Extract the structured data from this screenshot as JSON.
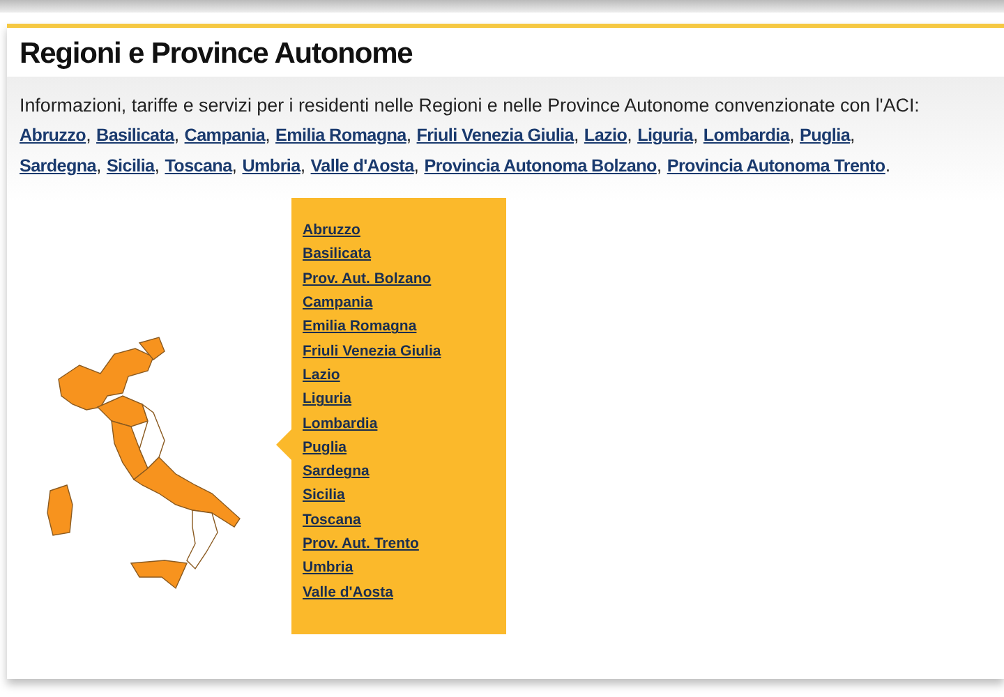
{
  "title": "Regioni e Province Autonome",
  "intro": {
    "text": "Informazioni, tariffe e servizi per i residenti nelle Regioni e nelle Province Autonome convenzionate con l'ACI:",
    "links": [
      {
        "label": "Abruzzo",
        "after": ","
      },
      {
        "label": "Basilicata",
        "after": ","
      },
      {
        "label": "Campania",
        "after": ","
      },
      {
        "label": "Emilia Romagna",
        "after": ","
      },
      {
        "label": "Friuli Venezia Giulia",
        "after": ","
      },
      {
        "label": "Lazio",
        "after": ","
      },
      {
        "label": "Liguria",
        "after": ","
      },
      {
        "label": "Lombardia",
        "after": ","
      },
      {
        "label": "Puglia",
        "after": ","
      },
      {
        "label": "Sardegna",
        "after": ","
      },
      {
        "label": "Sicilia",
        "after": ","
      },
      {
        "label": "Toscana",
        "after": ","
      },
      {
        "label": "Umbria",
        "after": ","
      },
      {
        "label": "Valle d'Aosta",
        "after": ","
      },
      {
        "label": "Provincia Autonoma Bolzano",
        "after": ","
      },
      {
        "label": "Provincia Autonoma Trento",
        "after": "."
      }
    ]
  },
  "region_menu": [
    "Abruzzo",
    "Basilicata",
    "Prov. Aut. Bolzano",
    "Campania",
    "Emilia Romagna",
    "Friuli Venezia Giulia",
    "Lazio",
    "Liguria",
    "Lombardia",
    "Puglia",
    "Sardegna",
    "Sicilia",
    "Toscana",
    "Prov. Aut. Trento",
    "Umbria",
    "Valle d'Aosta"
  ]
}
